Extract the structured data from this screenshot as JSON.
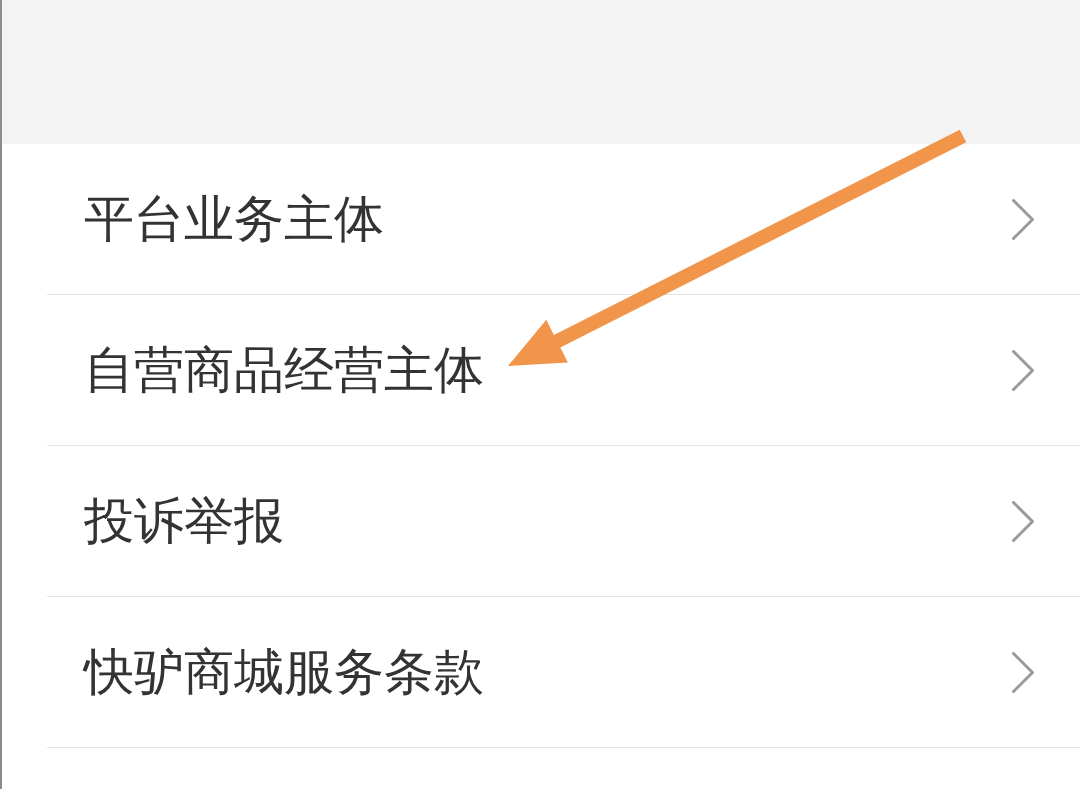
{
  "menu_items": [
    {
      "label": "平台业务主体"
    },
    {
      "label": "自营商品经营主体"
    },
    {
      "label": "投诉举报"
    },
    {
      "label": "快驴商城服务条款"
    }
  ]
}
